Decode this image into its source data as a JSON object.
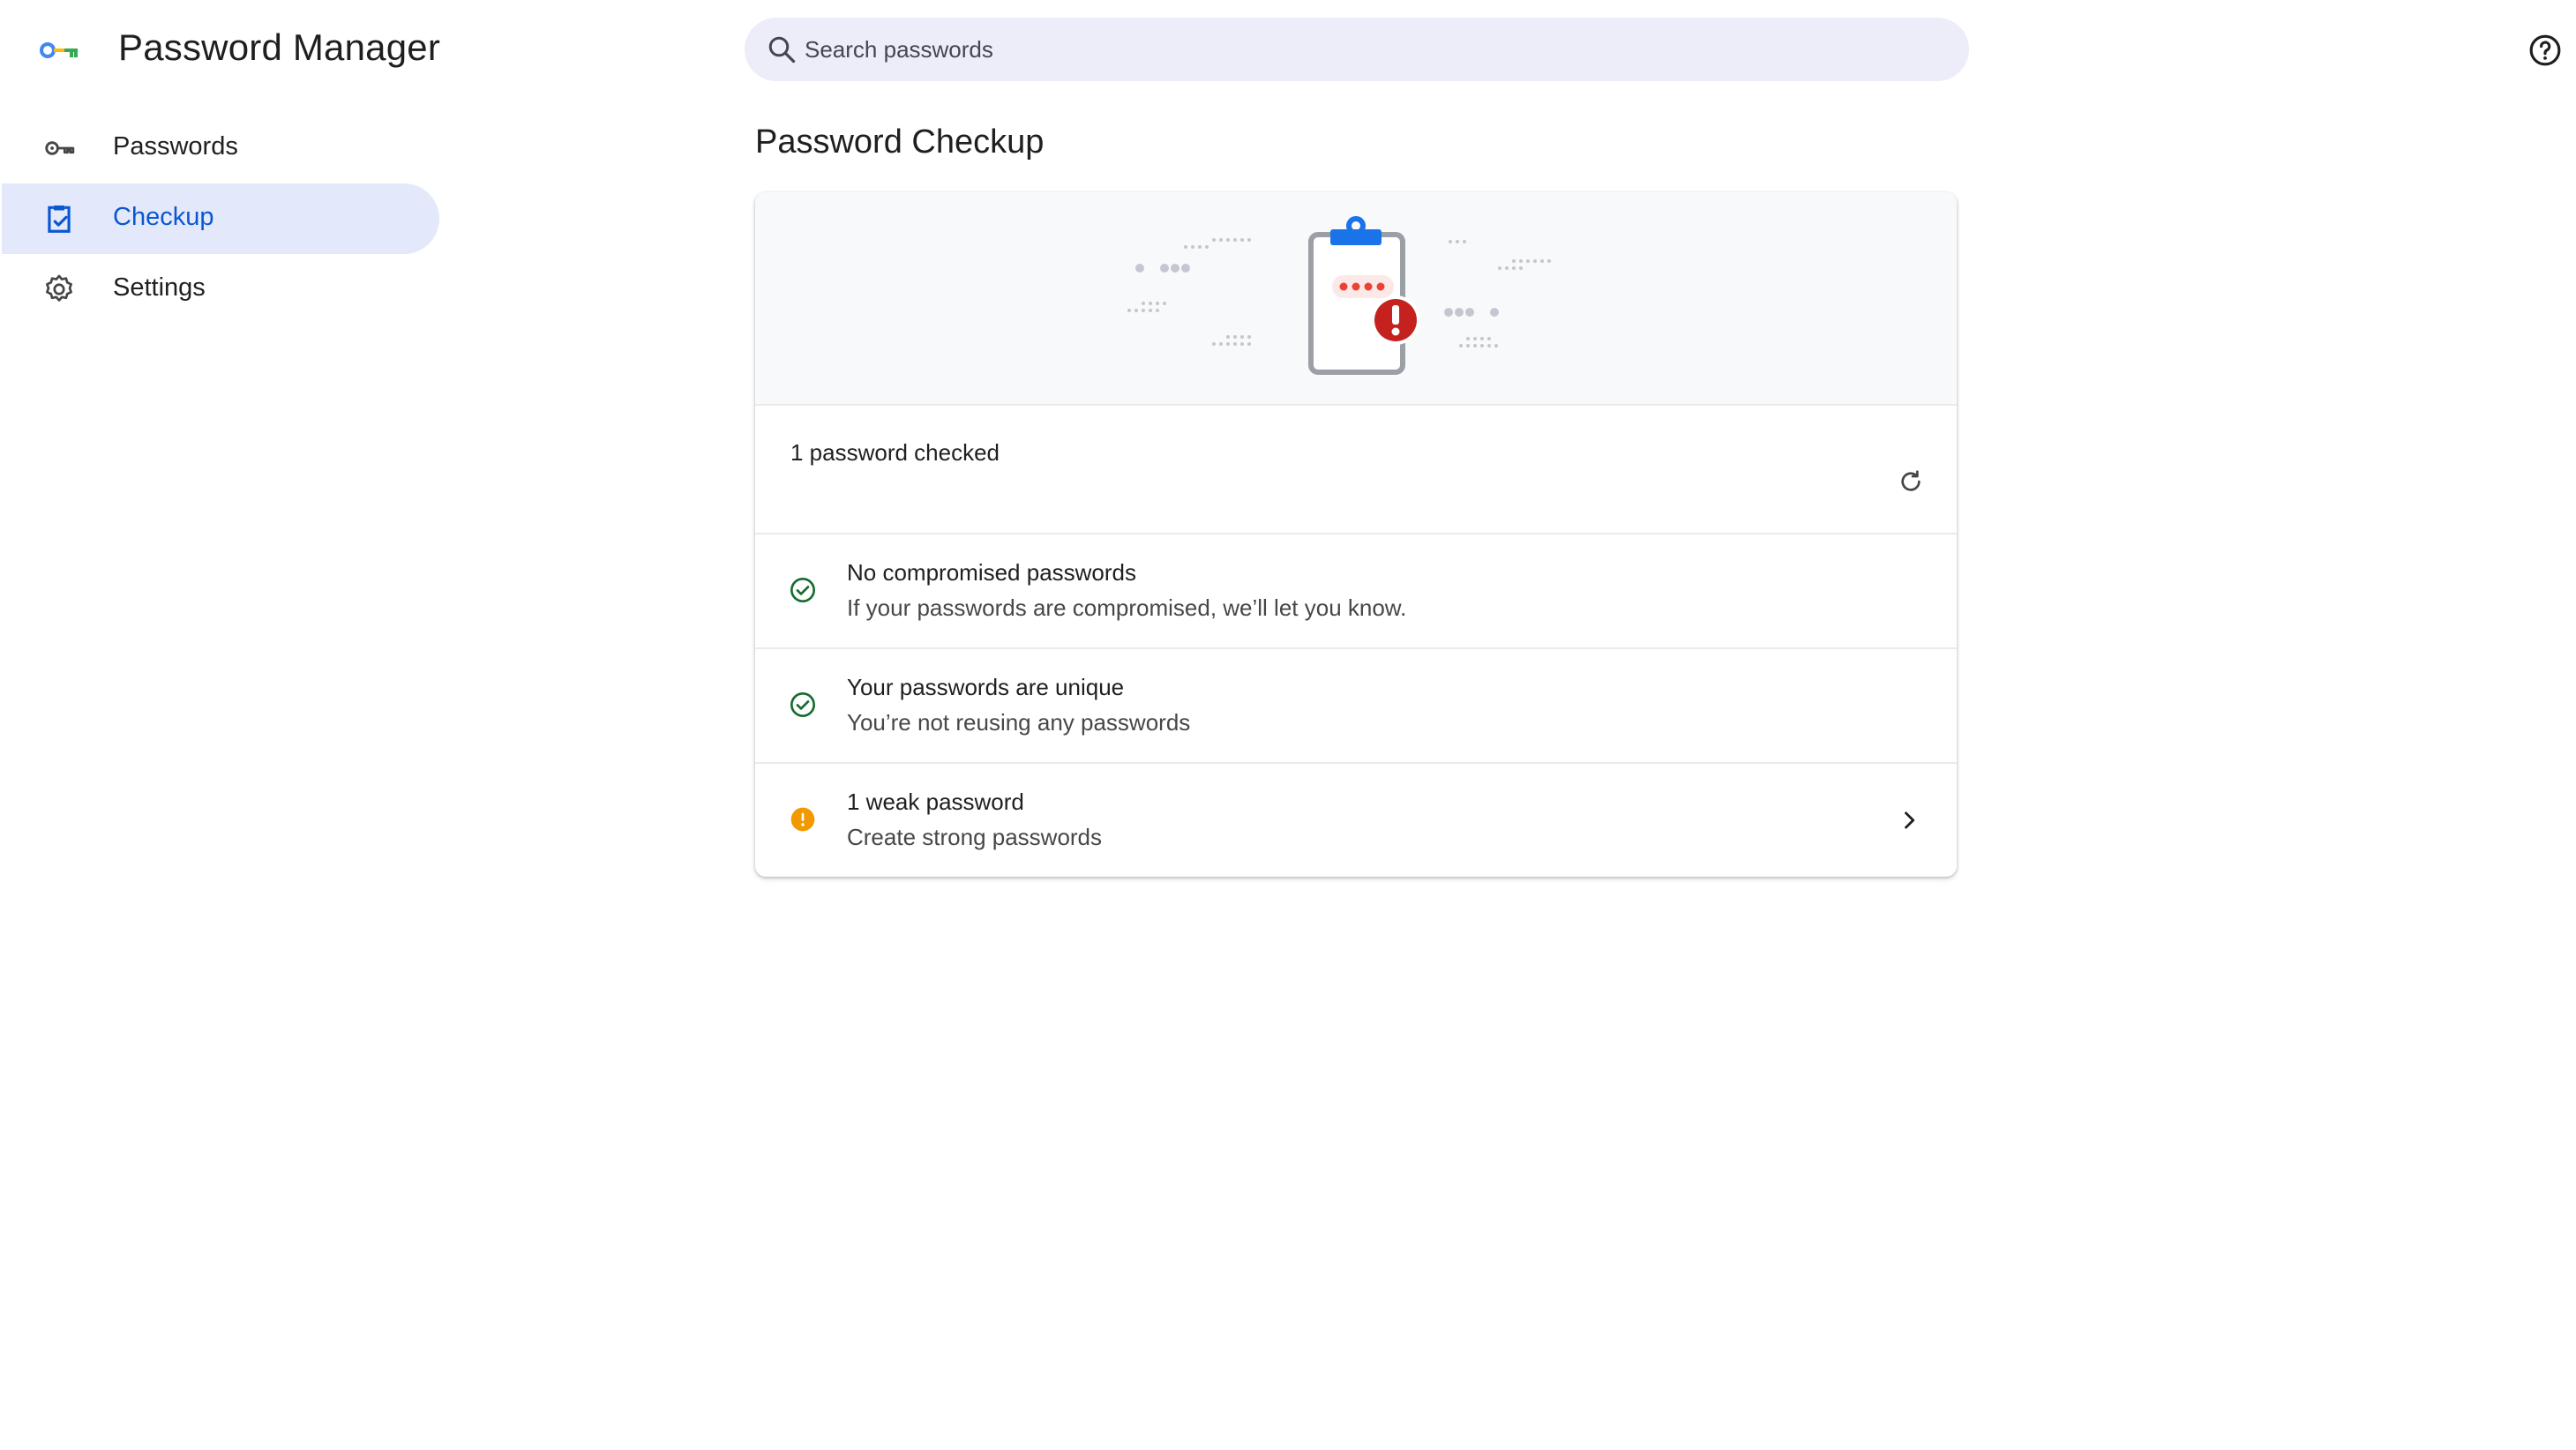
{
  "app": {
    "title": "Password Manager"
  },
  "search": {
    "placeholder": "Search passwords",
    "value": ""
  },
  "header": {
    "help_icon": "help-circle-icon"
  },
  "sidebar": {
    "items": [
      {
        "label": "Passwords",
        "icon": "key-icon",
        "active": false
      },
      {
        "label": "Checkup",
        "icon": "clipboard-check-icon",
        "active": true
      },
      {
        "label": "Settings",
        "icon": "gear-icon",
        "active": false
      }
    ]
  },
  "main": {
    "title": "Password Checkup",
    "checked_text": "1 password checked",
    "results": [
      {
        "title": "No compromised passwords",
        "subtitle": "If your passwords are compromised, we’ll let you know.",
        "status": "ok"
      },
      {
        "title": "Your passwords are unique",
        "subtitle": "You’re not reusing any passwords",
        "status": "ok"
      },
      {
        "title": "1 weak password",
        "subtitle": "Create strong passwords",
        "status": "warning"
      }
    ]
  },
  "colors": {
    "accent": "#0b57d0",
    "active_bg": "#e3e9fb",
    "ok_green": "#146c2e",
    "warning_orange": "#f29900",
    "error_red": "#c5221f"
  }
}
